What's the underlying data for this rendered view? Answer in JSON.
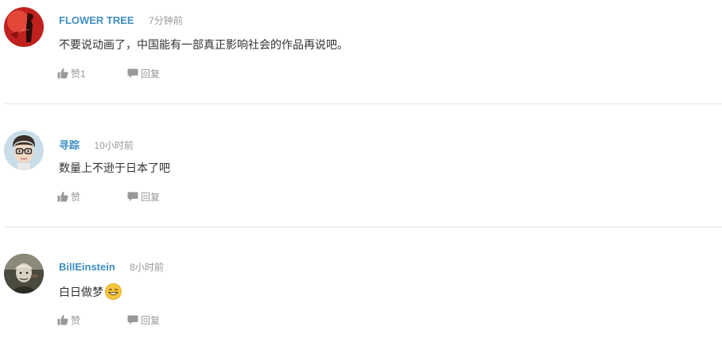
{
  "comments": [
    {
      "username": "FLOWER TREE",
      "time": "7分钟前",
      "text": "不要说动画了，中国能有一部真正影响社会的作品再说吧。",
      "like_label": "赞1",
      "reply_label": "回复",
      "avatar_icon": "red-avatar-icon",
      "avatar_color": "#c0201e"
    },
    {
      "username": "寻踪",
      "time": "10小时前",
      "text": "数量上不逊于日本了吧",
      "like_label": "赞",
      "reply_label": "回复",
      "avatar_icon": "cartoon-face-avatar-icon",
      "avatar_color": "#c9dde8"
    },
    {
      "username": "BillEinstein",
      "time": "8小时前",
      "text": "白日做梦",
      "emoji": "grinning-face-emoji",
      "like_label": "赞",
      "reply_label": "回复",
      "avatar_icon": "photo-avatar-icon",
      "avatar_color": "#4a4a3e"
    }
  ],
  "colors": {
    "username": "#3f8fc2",
    "meta": "#999999",
    "text": "#333333",
    "divider": "#e8e8e8"
  }
}
